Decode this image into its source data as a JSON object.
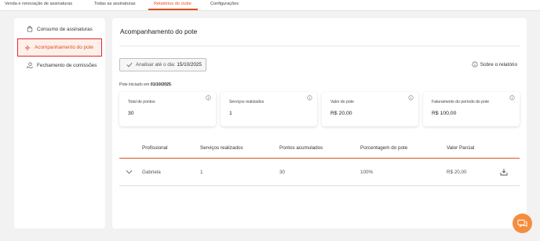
{
  "tabs": [
    {
      "label": "Venda e renovação de assinaturas"
    },
    {
      "label": "Todas as assinaturas"
    },
    {
      "label": "Relatórios do clube"
    },
    {
      "label": "Configurações"
    }
  ],
  "sidebar": {
    "items": [
      {
        "label": "Consumo de assinaturas",
        "icon": "shopping-bag-icon"
      },
      {
        "label": "Acompanhamento do pote",
        "icon": "sparkle-icon",
        "active": true
      },
      {
        "label": "Fechamento de comissões",
        "icon": "money-hand-icon"
      }
    ]
  },
  "main": {
    "title": "Acompanhamento do pote",
    "analisar_label": "Analisar até o dia:",
    "analisar_date": "15/10/2025",
    "sobre_label": "Sobre o relatório",
    "pote_prefix": "Pote iniciado em",
    "pote_date": "01/10/2025",
    "pote_suffix": ".",
    "cards": [
      {
        "label": "Total de pontos",
        "value": "30"
      },
      {
        "label": "Serviços realizados",
        "value": "1"
      },
      {
        "label": "Valor do pote",
        "value": "R$ 20,00"
      },
      {
        "label": "Faturamento do período do pote",
        "value": "R$ 100,00"
      }
    ],
    "table": {
      "headers": [
        "Profissional",
        "Serviços realizados",
        "Pontos acumulados",
        "Porcentagem do pote",
        "Valor Parcial"
      ],
      "rows": [
        {
          "profissional": "Gabriela",
          "servicos": "1",
          "pontos": "30",
          "porcentagem": "100%",
          "valor": "R$ 20,00"
        }
      ]
    }
  },
  "colors": {
    "accent": "#e0501b",
    "highlight_border": "#e4262b",
    "chat_button": "#f58d3f"
  }
}
